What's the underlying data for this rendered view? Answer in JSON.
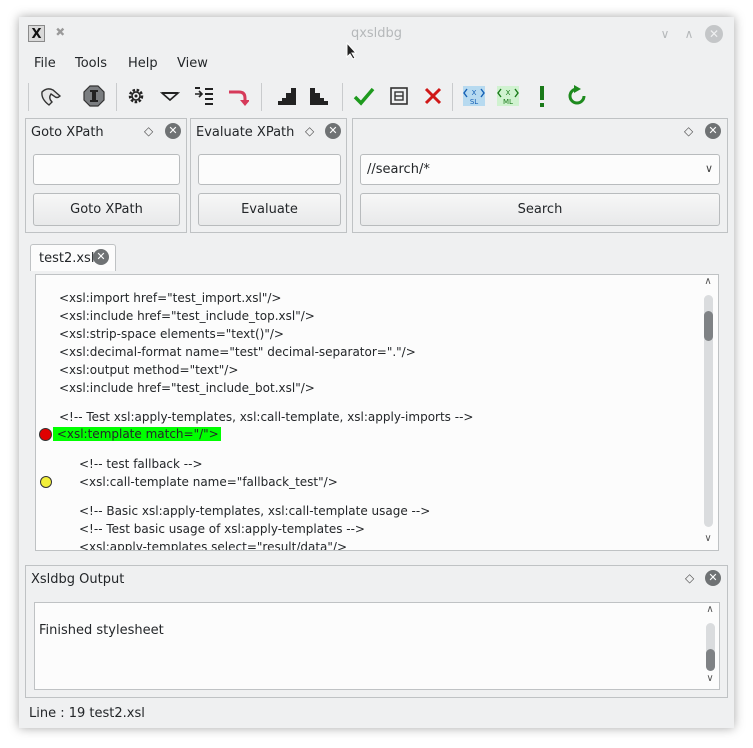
{
  "window": {
    "title": "qxsldbg"
  },
  "menubar": {
    "items": [
      "File",
      "Tools",
      "Help",
      "View"
    ]
  },
  "toolbar": {
    "icons": [
      "configure-icon",
      "inspect-icon",
      "settings-gear-icon",
      "step-down-icon",
      "step-into-icon",
      "step-up-icon",
      "stairs-up-icon",
      "stairs-down-icon",
      "continue-check-icon",
      "run-frame-icon",
      "stop-cross-icon",
      "xsl-source-icon",
      "xml-data-icon",
      "exclamation-icon",
      "reload-icon"
    ],
    "colors": {
      "check": "#1e9a1e",
      "cross": "#d01818",
      "reload": "#1e8a1e",
      "exclam": "#1a7a1a",
      "step": "#d63a5a"
    }
  },
  "goto_xpath": {
    "title": "Goto XPath",
    "input_value": "",
    "button": "Goto XPath"
  },
  "evaluate_xpath": {
    "title": "Evaluate XPath",
    "input_value": "",
    "button": "Evaluate"
  },
  "search": {
    "combo_value": "//search/*",
    "button": "Search"
  },
  "editor": {
    "tab_label": "test2.xsl",
    "lines": [
      "<xsl:import href=\"test_import.xsl\"/>",
      "<xsl:include href=\"test_include_top.xsl\"/>",
      "<xsl:strip-space elements=\"text()\"/>",
      "<xsl:decimal-format name=\"test\" decimal-separator=\".\"/>",
      "<xsl:output method=\"text\"/>",
      "<xsl:include href=\"test_include_bot.xsl\"/>",
      "<!-- Test xsl:apply-templates, xsl:call-template, xsl:apply-imports -->",
      " <xsl:template match=\"/\">",
      "<!-- test fallback -->",
      "<xsl:call-template name=\"fallback_test\"/>",
      "<!-- Basic xsl:apply-templates, xsl:call-template usage -->",
      "<!-- Test basic usage of xsl:apply-templates -->",
      "<xsl:apply-templates select=\"result/data\"/>"
    ],
    "highlight_color": "#00ff00",
    "breakpoint_color": "#e00000",
    "disabled_breakpoint_color": "#f2ef3a"
  },
  "output": {
    "title": "Xsldbg Output",
    "text": "Finished stylesheet"
  },
  "status": {
    "text": "Line : 19 test2.xsl"
  }
}
